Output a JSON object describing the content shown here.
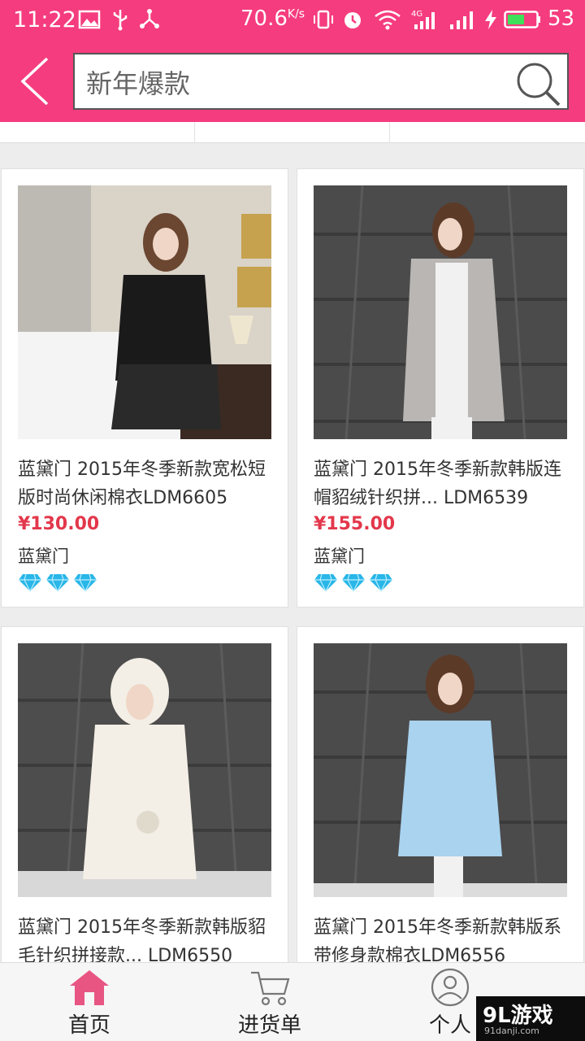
{
  "status_bar": {
    "time": "11:22",
    "speed": "70.6",
    "speed_unit": "K/s",
    "battery": "53",
    "icons": [
      "image-icon",
      "usb-icon",
      "share-icon",
      "vibrate-icon",
      "alarm-icon",
      "wifi-icon",
      "signal-4g-icon",
      "signal-icon",
      "charging-icon",
      "battery-icon"
    ]
  },
  "header": {
    "back_icon": "chevron-left-icon",
    "search_value": "新年爆款",
    "search_icon": "search-icon"
  },
  "colors": {
    "brand": "#f53c7e",
    "price": "#e3374b",
    "gem": "#29b6e8"
  },
  "products": [
    {
      "title": "蓝黛门 2015年冬季新款宽松短版时尚休闲棉衣LDM6605",
      "price": "¥130.00",
      "brand": "蓝黛门",
      "gems": 3,
      "coat_color": "#1a1a1a"
    },
    {
      "title": "蓝黛门 2015年冬季新款韩版连帽貂绒针织拼... LDM6539",
      "price": "¥155.00",
      "brand": "蓝黛门",
      "gems": 3,
      "coat_color": "#b9b6b3"
    },
    {
      "title": "蓝黛门 2015年冬季新款韩版貂毛针织拼接款... LDM6550",
      "price": "",
      "brand": "",
      "gems": 0,
      "coat_color": "#f3efe6"
    },
    {
      "title": "蓝黛门 2015年冬季新款韩版系带修身款棉衣LDM6556",
      "price": "",
      "brand": "",
      "gems": 0,
      "coat_color": "#a9d3ef"
    }
  ],
  "bottom_nav": [
    {
      "label": "首页",
      "icon": "home-icon",
      "active": true
    },
    {
      "label": "进货单",
      "icon": "cart-icon",
      "active": false
    },
    {
      "label": "个人",
      "icon": "user-icon",
      "active": false
    }
  ],
  "watermark": {
    "main": "9L游戏",
    "sub": "91danji.com"
  }
}
